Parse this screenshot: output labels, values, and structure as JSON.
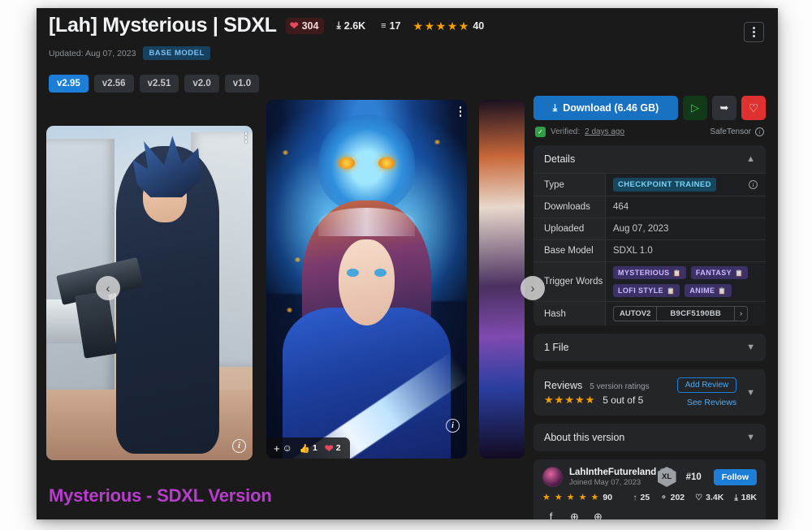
{
  "header": {
    "title": "[Lah] Mysterious | SDXL",
    "likes": "304",
    "downloads": "2.6K",
    "comments": "17",
    "rating_count": "40",
    "updated": "Updated: Aug 07, 2023",
    "base_model_badge": "BASE MODEL",
    "menu_icon": "kebab-menu-icon"
  },
  "versions": [
    {
      "label": "v2.95",
      "active": true
    },
    {
      "label": "v2.56",
      "active": false
    },
    {
      "label": "v2.51",
      "active": false
    },
    {
      "label": "v2.0",
      "active": false
    },
    {
      "label": "v1.0",
      "active": false
    }
  ],
  "carousel": {
    "prev_icon": "chevron-left-icon",
    "next_icon": "chevron-right-icon",
    "info_icon": "info-icon",
    "reactions": {
      "add_label": "+",
      "emoji_icon": "smiley-face-icon",
      "thumbsup_icon": "thumbs-up-icon",
      "thumbsup_count": "1",
      "heart_icon": "heart-icon",
      "heart_count": "2"
    }
  },
  "sidebar": {
    "download_label": "Download (6.46 GB)",
    "download_icon": "download-icon",
    "run_icon": "play-icon",
    "share_icon": "share-icon",
    "favorite_icon": "heart-icon",
    "verified_prefix": "Verified:",
    "verified_time": "2 days ago",
    "safetensor_label": "SafeTensor",
    "details": {
      "title": "Details",
      "rows": [
        {
          "key": "Type",
          "value": "CHECKPOINT TRAINED",
          "kind": "chip"
        },
        {
          "key": "Downloads",
          "value": "464",
          "kind": "text"
        },
        {
          "key": "Uploaded",
          "value": "Aug 07, 2023",
          "kind": "text"
        },
        {
          "key": "Base Model",
          "value": "SDXL 1.0",
          "kind": "text"
        }
      ],
      "trigger_words_key": "Trigger Words",
      "trigger_words": [
        "MYSTERIOUS",
        "FANTASY",
        "LOFI STYLE",
        "ANIME"
      ],
      "hash_key": "Hash",
      "hash_algo": "AUTOV2",
      "hash_value": "B9CF5190BB",
      "hash_more": "›"
    },
    "files": {
      "title": "1 File"
    },
    "reviews": {
      "title": "Reviews",
      "subtitle": "5 version ratings",
      "score": "5 out of 5",
      "stars": 5,
      "add_review_label": "Add Review",
      "see_reviews_label": "See Reviews"
    },
    "about": {
      "title": "About this version"
    },
    "creator": {
      "name": "LahIntheFutureland",
      "name_badge": "XL",
      "joined": "Joined May 07, 2023",
      "rank_badge": "XL",
      "rank": "#10",
      "follow_label": "Follow",
      "rating_value": "90",
      "rating_stars": 5,
      "metrics": [
        {
          "icon": "upload-icon",
          "glyph": "↑",
          "value": "25"
        },
        {
          "icon": "followers-icon",
          "glyph": "⚬",
          "value": "202"
        },
        {
          "icon": "heart-icon",
          "glyph": "♡",
          "value": "3.4K"
        },
        {
          "icon": "download-icon",
          "glyph": "⤓",
          "value": "18K"
        }
      ],
      "socials": [
        {
          "icon": "facebook-icon",
          "glyph": "f"
        },
        {
          "icon": "globe-icon",
          "glyph": "⊕"
        },
        {
          "icon": "website-icon",
          "glyph": "⊕"
        }
      ]
    }
  },
  "footer": {
    "caption": "Mysterious - SDXL Version"
  },
  "colors": {
    "accent_blue": "#1971c2",
    "accent_magenta": "#b93ccf",
    "star_orange": "#f59f00",
    "heart_red": "#e03131",
    "panel_bg": "#232528",
    "app_bg": "#1a1a1a"
  }
}
